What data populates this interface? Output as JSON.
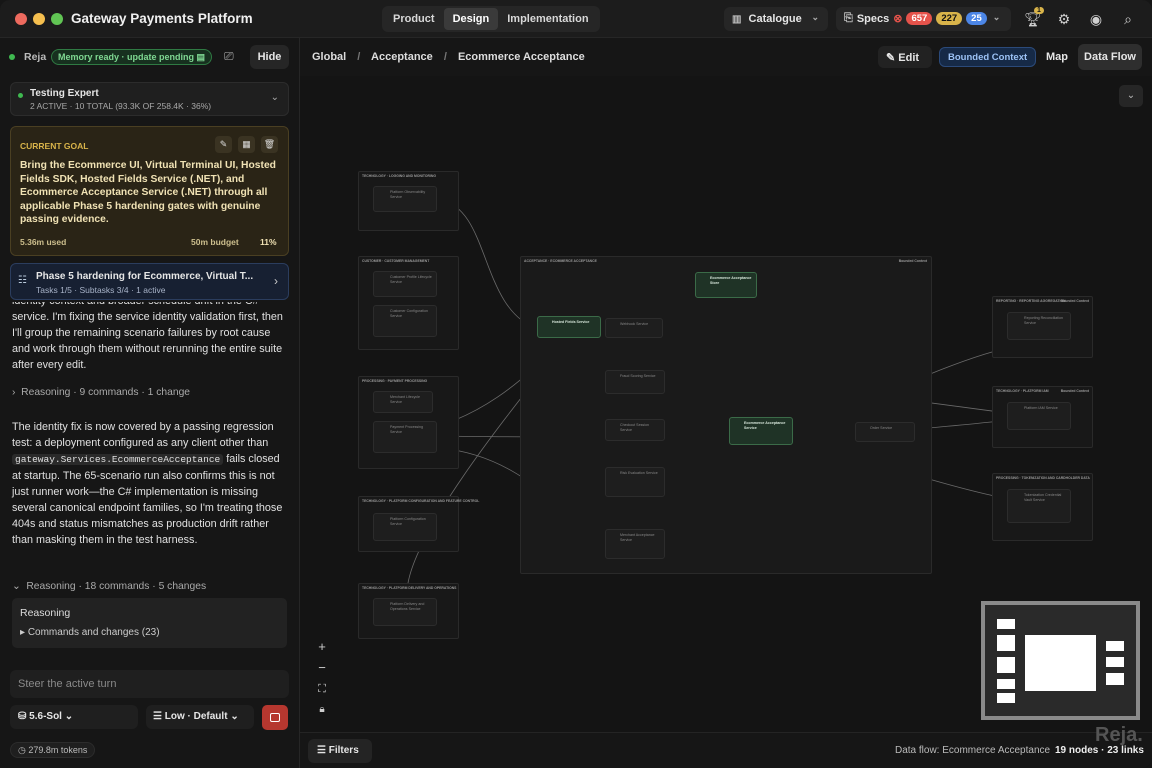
{
  "app": {
    "title": "Gateway Payments Platform"
  },
  "nav_tabs": [
    {
      "label": "Product"
    },
    {
      "label": "Design"
    },
    {
      "label": "Implementation"
    }
  ],
  "topbar": {
    "catalogue_label": "Catalogue",
    "specs_label": "Specs",
    "specs_counts": [
      "657",
      "227",
      "25"
    ],
    "trophy_badge": "1"
  },
  "sidebar": {
    "user": "Reja",
    "memory_status": "Memory ready · update pending",
    "hide_label": "Hide",
    "agent": {
      "name": "Testing Expert",
      "summary": "2 ACTIVE · 10 TOTAL (93.3K OF 258.4K · 36%)"
    },
    "goal": {
      "heading": "CURRENT GOAL",
      "text": "Bring the Ecommerce UI, Virtual Terminal UI, Hosted Fields SDK, Hosted Fields Service (.NET), and Ecommerce Acceptance Service (.NET) through all applicable Phase 5 hardening gates with genuine passing evidence.",
      "used": "5.36m used",
      "budget": "50m budget",
      "percent": "11%"
    },
    "task": {
      "title": "Phase 5 hardening for Ecommerce, Virtual T...",
      "meta": "Tasks 1/5 · Subtasks 3/4 · 1 active"
    },
    "chat_p1": "identity context and broader schedule drift in the C# service. I'm fixing the service identity validation first, then I'll group the remaining scenario failures by root cause and work through them without rerunning the entire suite after every edit.",
    "reasoning1": "Reasoning · 9 commands · 1 change",
    "chat_p2_a": "The identity fix is now covered by a passing regression test: a deployment configured as any client other than",
    "chat_code": "gateway.Services.EcommerceAcceptance",
    "chat_p2_b": "fails closed at startup. The 65-scenario run also confirms this is not just runner work—the C# implementation is missing several canonical endpoint families, so I'm treating those 404s and status mismatches as production drift rather than masking them in the test harness.",
    "reasoning2": "Reasoning · 18 commands · 5 changes",
    "reasoning_box_title": "Reasoning",
    "reasoning_box_item": "Commands and changes (23)",
    "steer_placeholder": "Steer the active turn",
    "model": "5.6-Sol",
    "effort": "Low · Default",
    "tokens": "279.8m tokens"
  },
  "breadcrumb": [
    "Global",
    "Acceptance",
    "Ecommerce Acceptance"
  ],
  "view": {
    "edit": "Edit",
    "context": "Bounded Context",
    "map": "Map",
    "dataflow": "Data Flow"
  },
  "graph": {
    "groups": [
      "TECHNOLOGY · LOGGING AND MONITORING",
      "CUSTOMER · CUSTOMER MANAGEMENT",
      "PROCESSING · PAYMENT PROCESSING",
      "TECHNOLOGY · PLATFORM CONFIGURATION AND FEATURE CONTROL",
      "TECHNOLOGY · PLATFORM DELIVERY AND OPERATIONS",
      "ACCEPTANCE · ECOMMERCE ACCEPTANCE",
      "REPORTING · REPORTING AGGREGATION",
      "TECHNOLOGY · PLATFORM IAM",
      "PROCESSING · TOKENIZATION AND CARDHOLDER DATA"
    ],
    "bc_tag": "Bounded Context",
    "nodes": {
      "hosted": "Hosted Fields Service",
      "store": "Ecommerce Acceptance Store",
      "eas": "Ecommerce Acceptance Service",
      "observ": "Platform Observability Service",
      "profile": "Customer Profile Lifecycle Service",
      "custcfg": "Customer Configuration Service",
      "merch": "Merchant Lifecycle Service",
      "payment": "Payment Processing Service",
      "config": "Platform Configuration Service",
      "delivery": "Platform Delivery and Operations Service",
      "recon": "Reporting Reconciliation Service",
      "iam": "Platform IAM Service",
      "token": "Tokenization Credential Vault Service",
      "webhook": "Webhook Service",
      "fraud": "Fraud Scoring Service",
      "checkout": "Checkout Session Service",
      "risk": "Risk Evaluation Service",
      "merchant": "Merchant Acceptance Service",
      "order": "Order Service"
    }
  },
  "footer": {
    "filters": "Filters",
    "dataflow_label": "Data flow: Ecommerce Acceptance",
    "counts": "19 nodes · 23 links",
    "watermark": "Reja."
  },
  "colors": {
    "accent_green": "#3fb950",
    "badge_red": "#e5534b",
    "badge_yellow": "#d9b44a",
    "badge_blue": "#4c86e6",
    "goal_bg": "#2a2416",
    "task_bg": "#172032"
  }
}
